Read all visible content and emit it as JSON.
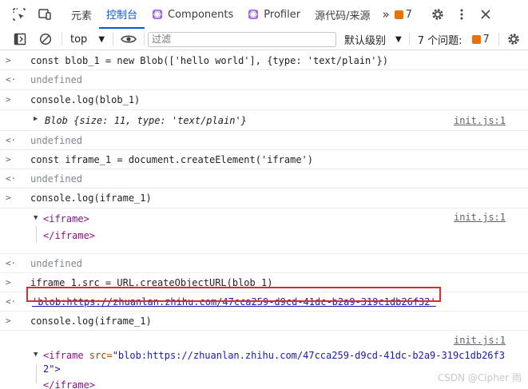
{
  "tabs": {
    "elements": "元素",
    "console": "控制台",
    "components": "Components",
    "profiler": "Profiler",
    "sources": "源代码/来源",
    "more": "»",
    "warn_count": "7"
  },
  "toolbar": {
    "context": "top",
    "filter_placeholder": "过滤",
    "levels": "默认级别",
    "issues_label": "7 个问题:",
    "issues_count": "7"
  },
  "console": {
    "r1": {
      "code": "const blob_1 = new Blob(['hello world'], {type: 'text/plain'})"
    },
    "r2": {
      "text": "undefined"
    },
    "r3": {
      "code": "console.log(blob_1)"
    },
    "r4": {
      "obj_name": "Blob",
      "obj_props": "{size: 11, type: 'text/plain'}",
      "link": "init.js:1"
    },
    "r5": {
      "text": "undefined"
    },
    "r6": {
      "code": "const iframe_1 = document.createElement('iframe')"
    },
    "r7": {
      "text": "undefined"
    },
    "r8": {
      "code": "console.log(iframe_1)"
    },
    "r9": {
      "open_tag": "<iframe>",
      "close_tag": "</iframe>",
      "link": "init.js:1"
    },
    "r10": {
      "text": "undefined"
    },
    "r11": {
      "code": "iframe_1.src = URL.createObjectURL(blob_1)"
    },
    "r12": {
      "url": "'blob:https://zhuanlan.zhihu.com/47cca259-d9cd-41dc-b2a9-319c1db26f32'"
    },
    "r13": {
      "code": "console.log(iframe_1)"
    },
    "r14": {
      "link": "init.js:1",
      "line1_tag": "<iframe",
      "line1_attr": " src=",
      "line1_val": "\"blob:https://zhuanlan.zhihu.com/47cca259-d9cd-41dc-b2a9-319c1db26f3",
      "line2": "2\">",
      "close_tag": "</iframe>"
    }
  },
  "watermark": "CSDN @Cipher 雨"
}
